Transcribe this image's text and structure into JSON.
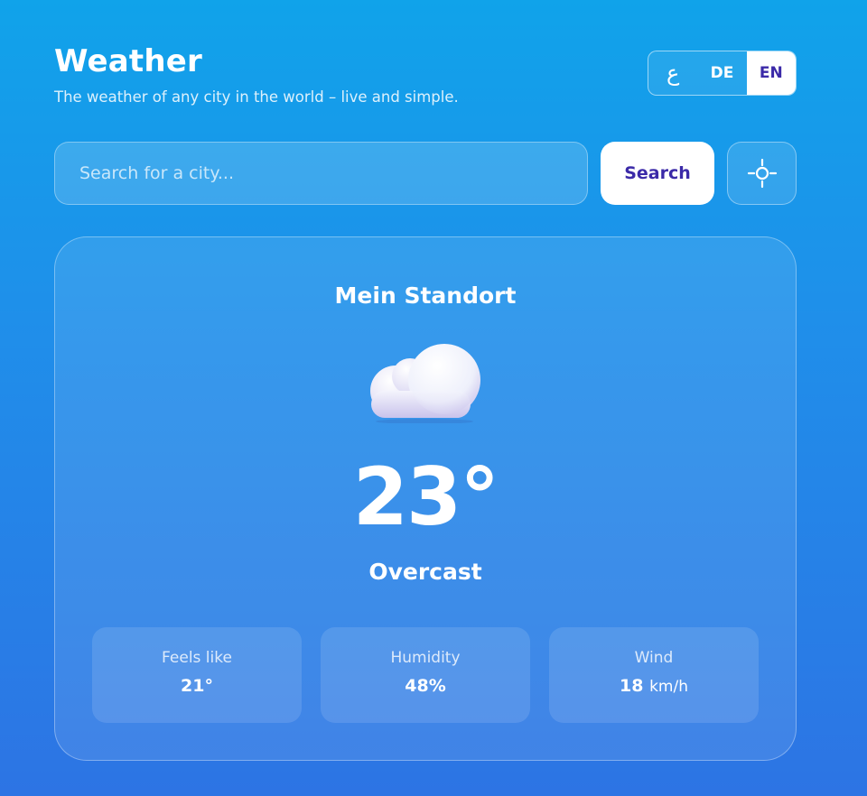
{
  "header": {
    "title": "Weather",
    "subtitle": "The weather of any city in the world – live and simple."
  },
  "languages": {
    "items": [
      {
        "label": "ع"
      },
      {
        "label": "DE"
      },
      {
        "label": "EN"
      }
    ],
    "active": "EN"
  },
  "search": {
    "placeholder": "Search for a city...",
    "value": "",
    "button_label": "Search",
    "locate_icon": "crosshair-icon"
  },
  "weather": {
    "location": "Mein Standort",
    "icon": "cloud-icon",
    "temperature": "23°",
    "condition": "Overcast",
    "stats": {
      "feels_like": {
        "label": "Feels like",
        "value": "21°"
      },
      "humidity": {
        "label": "Humidity",
        "value": "48%"
      },
      "wind": {
        "label": "Wind",
        "value": "18",
        "unit": "km/h"
      }
    }
  },
  "colors": {
    "accent": "#3b2aa8",
    "background_top": "#10a3ea",
    "background_bottom": "#2d74e4"
  }
}
